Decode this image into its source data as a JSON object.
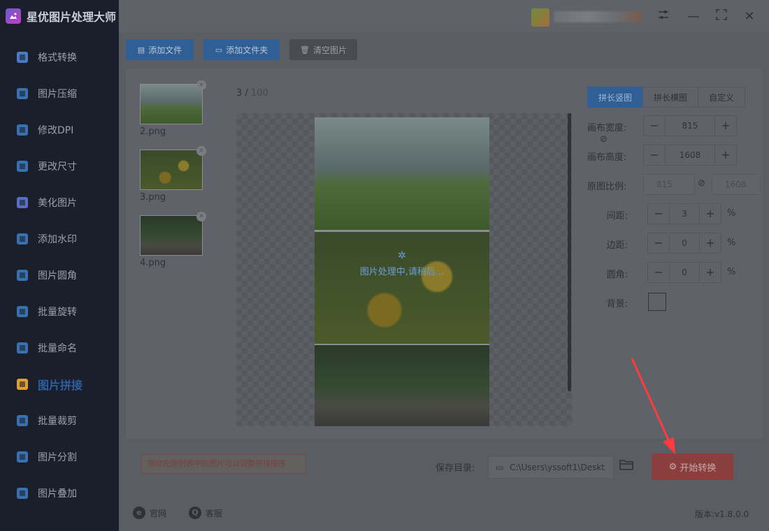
{
  "app": {
    "title": "星优图片处理大师"
  },
  "sidebar": {
    "items": [
      {
        "label": "格式转换",
        "icon": "image-convert-icon",
        "color": "#4a7bc0"
      },
      {
        "label": "图片压缩",
        "icon": "image-compress-icon",
        "color": "#3a6fb0"
      },
      {
        "label": "修改DPI",
        "icon": "dpi-icon",
        "color": "#3a6fb0"
      },
      {
        "label": "更改尺寸",
        "icon": "resize-icon",
        "color": "#3a6fb0"
      },
      {
        "label": "美化图片",
        "icon": "beautify-icon",
        "color": "#5a6fc0"
      },
      {
        "label": "添加水印",
        "icon": "watermark-icon",
        "color": "#3a6fb0"
      },
      {
        "label": "图片圆角",
        "icon": "round-corner-icon",
        "color": "#3a6fb0"
      },
      {
        "label": "批量旋转",
        "icon": "rotate-icon",
        "color": "#3a6fb0"
      },
      {
        "label": "批量命名",
        "icon": "rename-icon",
        "color": "#3a6fb0"
      },
      {
        "label": "图片拼接",
        "icon": "image-stitch-icon",
        "color": "#e0a030",
        "active": true
      },
      {
        "label": "批量裁剪",
        "icon": "crop-icon",
        "color": "#3a6fb0"
      },
      {
        "label": "图片分割",
        "icon": "split-icon",
        "color": "#3a6fb0"
      },
      {
        "label": "图片叠加",
        "icon": "overlay-icon",
        "color": "#3a6fb0"
      }
    ]
  },
  "toolbar": {
    "add_file": "添加文件",
    "add_folder": "添加文件夹",
    "clear_images": "清空图片"
  },
  "file_list": [
    {
      "name": "2.png"
    },
    {
      "name": "3.png"
    },
    {
      "name": "4.png"
    }
  ],
  "preview": {
    "current": "3",
    "total": "100",
    "loading_text": "图片处理中,请稍后..."
  },
  "settings": {
    "tabs": [
      "拼长竖图",
      "拼长横图",
      "自定义"
    ],
    "canvas_width_label": "画布宽度:",
    "canvas_width": "815",
    "canvas_height_label": "画布高度:",
    "canvas_height": "1608",
    "ratio_label": "原图比例:",
    "ratio_width": "815",
    "ratio_height": "1608",
    "spacing_label": "间距:",
    "spacing": "3",
    "margin_label": "边距:",
    "margin": "0",
    "radius_label": "圆角:",
    "radius": "0",
    "percent": "%",
    "background_label": "背景:"
  },
  "bottom": {
    "hint": "拖动左侧列表中的图片可以调整拼接顺序",
    "save_label": "保存目录:",
    "save_path": "C:\\Users\\yssoft1\\Deskt",
    "start_button": "开始转换"
  },
  "footer": {
    "website": "官网",
    "support": "客服",
    "version": "版本:v1.8.0.0"
  },
  "colors": {
    "accent_blue": "#2f5f95",
    "start_red": "#8a3f3e",
    "annotation_arrow": "#ff3b3b"
  }
}
